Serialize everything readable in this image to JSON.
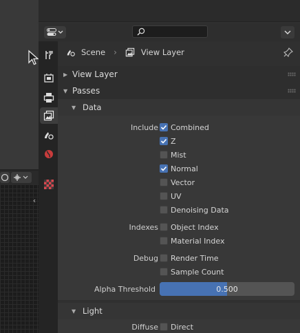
{
  "search": {
    "placeholder": ""
  },
  "breadcrumb": {
    "scene": "Scene",
    "view_layer": "View Layer"
  },
  "panels": {
    "view_layer": "View Layer",
    "passes": "Passes",
    "data": "Data",
    "light": "Light"
  },
  "data_panel": {
    "include_label": "Include",
    "include": [
      {
        "label": "Combined",
        "checked": true
      },
      {
        "label": "Z",
        "checked": true
      },
      {
        "label": "Mist",
        "checked": false
      },
      {
        "label": "Normal",
        "checked": true
      },
      {
        "label": "Vector",
        "checked": false
      },
      {
        "label": "UV",
        "checked": false
      },
      {
        "label": "Denoising Data",
        "checked": false
      }
    ],
    "indexes_label": "Indexes",
    "indexes": [
      {
        "label": "Object Index",
        "checked": false
      },
      {
        "label": "Material Index",
        "checked": false
      }
    ],
    "debug_label": "Debug",
    "debug": [
      {
        "label": "Render Time",
        "checked": false
      },
      {
        "label": "Sample Count",
        "checked": false
      }
    ],
    "alpha_threshold_label": "Alpha Threshold",
    "alpha_threshold": "0.500",
    "alpha_threshold_fraction": 0.5
  },
  "light_panel": {
    "diffuse_label": "Diffuse",
    "diffuse": [
      {
        "label": "Direct",
        "checked": false
      }
    ]
  },
  "colors": {
    "accent": "#4772b3",
    "panel_bg": "#303030",
    "subpanel_bg": "#383838"
  },
  "icons": {
    "tabs": [
      "tool-icon",
      "render-icon",
      "output-icon",
      "view-layer-icon",
      "scene-icon",
      "world-icon",
      "texture-icon"
    ]
  }
}
